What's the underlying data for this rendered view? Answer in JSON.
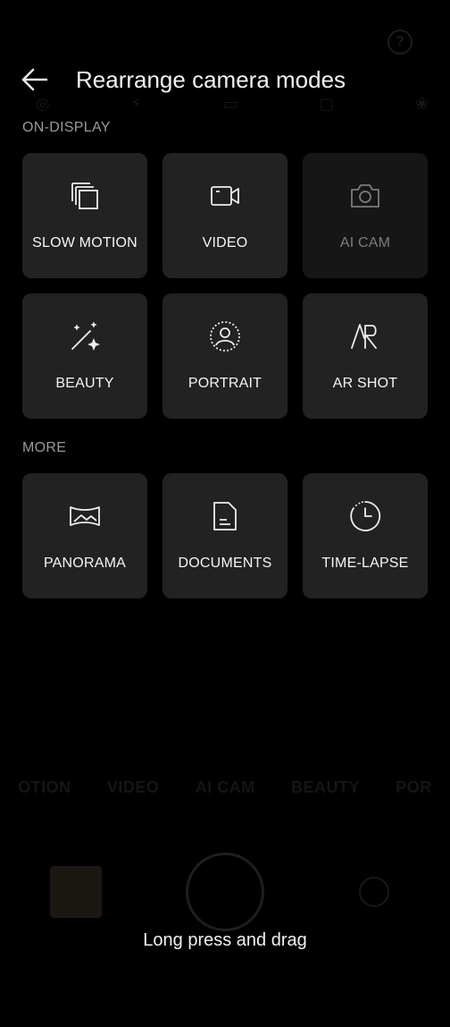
{
  "header": {
    "title": "Rearrange camera modes"
  },
  "background": {
    "mode_strip": [
      "OTION",
      "VIDEO",
      "AI CAM",
      "BEAUTY",
      "POR"
    ],
    "help_glyph": "?"
  },
  "sections": {
    "on_display": {
      "label": "ON-DISPLAY",
      "modes": [
        {
          "label": "SLOW MOTION",
          "icon": "slow-motion-icon"
        },
        {
          "label": "VIDEO",
          "icon": "video-icon"
        },
        {
          "label": "AI CAM",
          "icon": "camera-icon",
          "dimmed": true
        },
        {
          "label": "BEAUTY",
          "icon": "magic-wand-icon"
        },
        {
          "label": "PORTRAIT",
          "icon": "portrait-icon"
        },
        {
          "label": "AR SHOT",
          "icon": "ar-icon"
        }
      ]
    },
    "more": {
      "label": "MORE",
      "modes": [
        {
          "label": "PANORAMA",
          "icon": "panorama-icon"
        },
        {
          "label": "DOCUMENTS",
          "icon": "document-icon"
        },
        {
          "label": "TIME-LAPSE",
          "icon": "timer-icon"
        }
      ]
    }
  },
  "hint": "Long press and drag",
  "colors": {
    "tile_bg": "#222222",
    "dim_tile_bg": "#161616",
    "section_label": "#9a9a9a"
  }
}
